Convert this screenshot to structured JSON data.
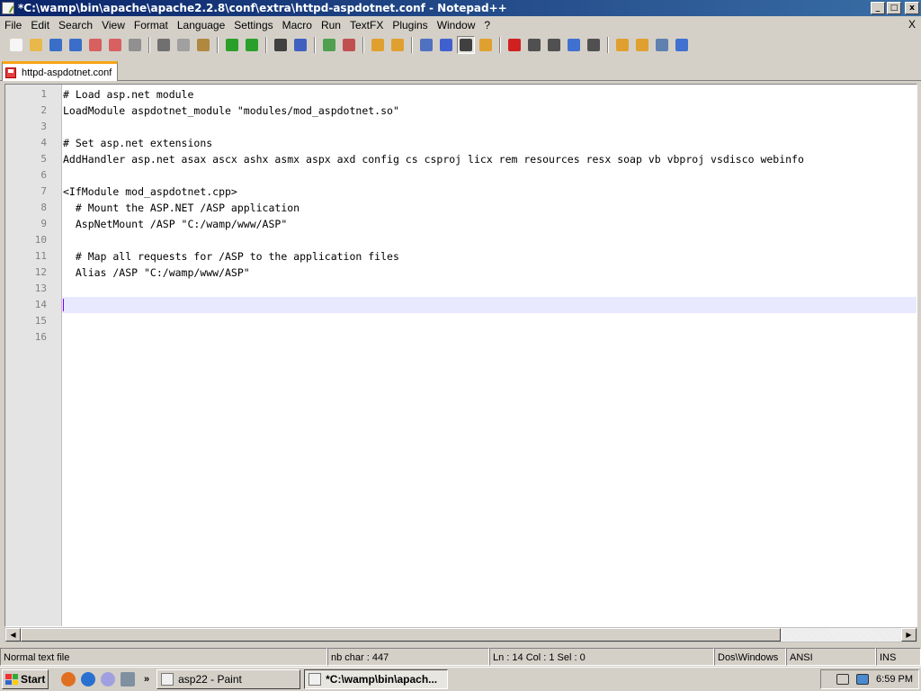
{
  "window": {
    "title": "*C:\\wamp\\bin\\apache\\apache2.2.8\\conf\\extra\\httpd-aspdotnet.conf - Notepad++",
    "controls": [
      "_",
      "□",
      "x"
    ]
  },
  "menu": {
    "items": [
      "File",
      "Edit",
      "Search",
      "View",
      "Format",
      "Language",
      "Settings",
      "Macro",
      "Run",
      "TextFX",
      "Plugins",
      "Window",
      "?"
    ],
    "close_doc": "X"
  },
  "toolbar": {
    "buttons": [
      {
        "icon": "new-file-icon",
        "color": "#f6f6f6"
      },
      {
        "icon": "open-file-icon",
        "color": "#e8b84a"
      },
      {
        "icon": "save-icon",
        "color": "#3a6ec8"
      },
      {
        "icon": "save-all-icon",
        "color": "#3a6ec8"
      },
      {
        "icon": "close-icon",
        "color": "#d86060"
      },
      {
        "icon": "close-all-icon",
        "color": "#d86060"
      },
      {
        "icon": "print-icon",
        "color": "#909090"
      },
      {
        "sep": true
      },
      {
        "icon": "cut-icon",
        "color": "#707070"
      },
      {
        "icon": "copy-icon",
        "color": "#a0a0a0"
      },
      {
        "icon": "paste-icon",
        "color": "#b08840"
      },
      {
        "sep": true
      },
      {
        "icon": "undo-icon",
        "color": "#2aa02a"
      },
      {
        "icon": "redo-icon",
        "color": "#2aa02a"
      },
      {
        "sep": true
      },
      {
        "icon": "find-icon",
        "color": "#404040"
      },
      {
        "icon": "replace-icon",
        "color": "#4060c0"
      },
      {
        "sep": true
      },
      {
        "icon": "zoom-in-icon",
        "color": "#50a050"
      },
      {
        "icon": "zoom-out-icon",
        "color": "#c05050"
      },
      {
        "sep": true
      },
      {
        "icon": "sync-vertical-icon",
        "color": "#e0a030"
      },
      {
        "icon": "sync-horizontal-icon",
        "color": "#e0a030"
      },
      {
        "sep": true
      },
      {
        "icon": "word-wrap-icon",
        "color": "#5070c0"
      },
      {
        "icon": "show-all-chars-icon",
        "color": "#4060d0"
      },
      {
        "icon": "indent-guide-icon",
        "color": "#404040",
        "active": true
      },
      {
        "icon": "user-lang-icon",
        "color": "#e0a030"
      },
      {
        "sep": true
      },
      {
        "icon": "record-macro-icon",
        "color": "#d02020"
      },
      {
        "icon": "stop-record-icon",
        "color": "#505050"
      },
      {
        "icon": "playback-icon",
        "color": "#505050"
      },
      {
        "icon": "run-macro-multiple-icon",
        "color": "#4070d0"
      },
      {
        "icon": "save-macro-icon",
        "color": "#505050"
      },
      {
        "sep": true
      },
      {
        "icon": "plugin-folder-icon",
        "color": "#e0a030"
      },
      {
        "icon": "explorer-icon",
        "color": "#e0a030"
      },
      {
        "icon": "console-icon",
        "color": "#6080b0"
      },
      {
        "icon": "spell-check-icon",
        "color": "#4070d0"
      }
    ]
  },
  "tabs": [
    {
      "label": "httpd-aspdotnet.conf",
      "active": true
    }
  ],
  "editor": {
    "current_line": 14,
    "lines": [
      {
        "n": "1",
        "text": "# Load asp.net module"
      },
      {
        "n": "2",
        "text": "LoadModule aspdotnet_module \"modules/mod_aspdotnet.so\""
      },
      {
        "n": "3",
        "text": ""
      },
      {
        "n": "4",
        "text": "# Set asp.net extensions"
      },
      {
        "n": "5",
        "text": "AddHandler asp.net asax ascx ashx asmx aspx axd config cs csproj licx rem resources resx soap vb vbproj vsdisco webinfo"
      },
      {
        "n": "6",
        "text": ""
      },
      {
        "n": "7",
        "text": "<IfModule mod_aspdotnet.cpp>"
      },
      {
        "n": "8",
        "text": "  # Mount the ASP.NET /ASP application"
      },
      {
        "n": "9",
        "text": "  AspNetMount /ASP \"C:/wamp/www/ASP\""
      },
      {
        "n": "10",
        "text": ""
      },
      {
        "n": "11",
        "text": "  # Map all requests for /ASP to the application files"
      },
      {
        "n": "12",
        "text": "  Alias /ASP \"C:/wamp/www/ASP\""
      },
      {
        "n": "13",
        "text": ""
      },
      {
        "n": "14",
        "text": ""
      },
      {
        "n": "15",
        "text": ""
      },
      {
        "n": "16",
        "text": ""
      }
    ]
  },
  "status": {
    "file_type": "Normal text file",
    "nb_char": "nb char : 447",
    "position": "Ln : 14    Col : 1    Sel : 0",
    "eol": "Dos\\Windows",
    "encoding": "ANSI",
    "mode": "INS"
  },
  "taskbar": {
    "start_label": "Start",
    "quick_launch": [
      "firefox-icon",
      "ie-icon",
      "wamp-icon",
      "network-icon"
    ],
    "more": "»",
    "tasks": [
      {
        "label": "asp22 - Paint",
        "active": false
      },
      {
        "label": "*C:\\wamp\\bin\\apach...",
        "active": true
      }
    ],
    "tray_icons": [
      "network-status-icon",
      "volume-icon"
    ],
    "clock": "6:59 PM"
  }
}
